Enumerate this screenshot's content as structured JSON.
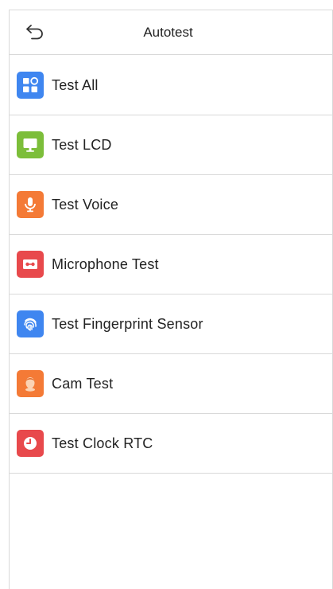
{
  "header": {
    "title": "Autotest",
    "back_icon": "back-arrow-icon"
  },
  "menu": {
    "items": [
      {
        "label": "Test All",
        "icon": "grid-icon",
        "color": "#3f86f0"
      },
      {
        "label": "Test LCD",
        "icon": "monitor-icon",
        "color": "#7cbe3a"
      },
      {
        "label": "Test Voice",
        "icon": "microphone-icon",
        "color": "#f47a36"
      },
      {
        "label": "Microphone Test",
        "icon": "cassette-icon",
        "color": "#e8494c"
      },
      {
        "label": "Test Fingerprint Sensor",
        "icon": "fingerprint-icon",
        "color": "#3f86f0"
      },
      {
        "label": "Cam Test",
        "icon": "face-icon",
        "color": "#f47a36"
      },
      {
        "label": "Test Clock RTC",
        "icon": "clock-icon",
        "color": "#e8494c"
      }
    ]
  }
}
